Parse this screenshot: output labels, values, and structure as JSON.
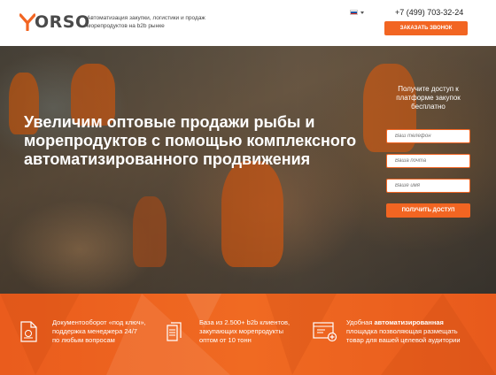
{
  "header": {
    "logo_text": "ORSO",
    "tagline": "Автоматизация закупки, логистики и продаж морепродуктов на b2b рынке",
    "phone": "+7 (499) 703-32-24",
    "call_button": "ЗАКАЗАТЬ ЗВОНОК",
    "language_flag": "ru"
  },
  "hero": {
    "title": "Увеличим оптовые продажи рыбы и морепродуктов с помощью комплексного автоматизированного продвижения",
    "form_caption": "Получите доступ к платформе закупок бесплатно",
    "fields": [
      {
        "placeholder": "Ваш телефон"
      },
      {
        "placeholder": "Ваша почта"
      },
      {
        "placeholder": "Ваше имя"
      }
    ],
    "submit_button": "ПОЛУЧИТЬ ДОСТУП"
  },
  "features": [
    {
      "icon": "document-icon",
      "line1": "Документооборот «под ключ»,",
      "line2": "поддержка менеджера 24/7",
      "line3": "по любым вопросам"
    },
    {
      "icon": "database-icon",
      "line1": "База из 2.500+ b2b клиентов,",
      "line2": "закупающих морепродукты",
      "line3": "оптом от 10 тонн"
    },
    {
      "icon": "platform-icon",
      "line1_prefix": "Удобная ",
      "line1_bold": "автоматизированная",
      "line2": "площадка позволяющая размещать",
      "line3": "товар для вашей целевой аудитории"
    }
  ],
  "colors": {
    "accent": "#f26522",
    "logo_y": "#f26522",
    "text_dark": "#222222"
  }
}
